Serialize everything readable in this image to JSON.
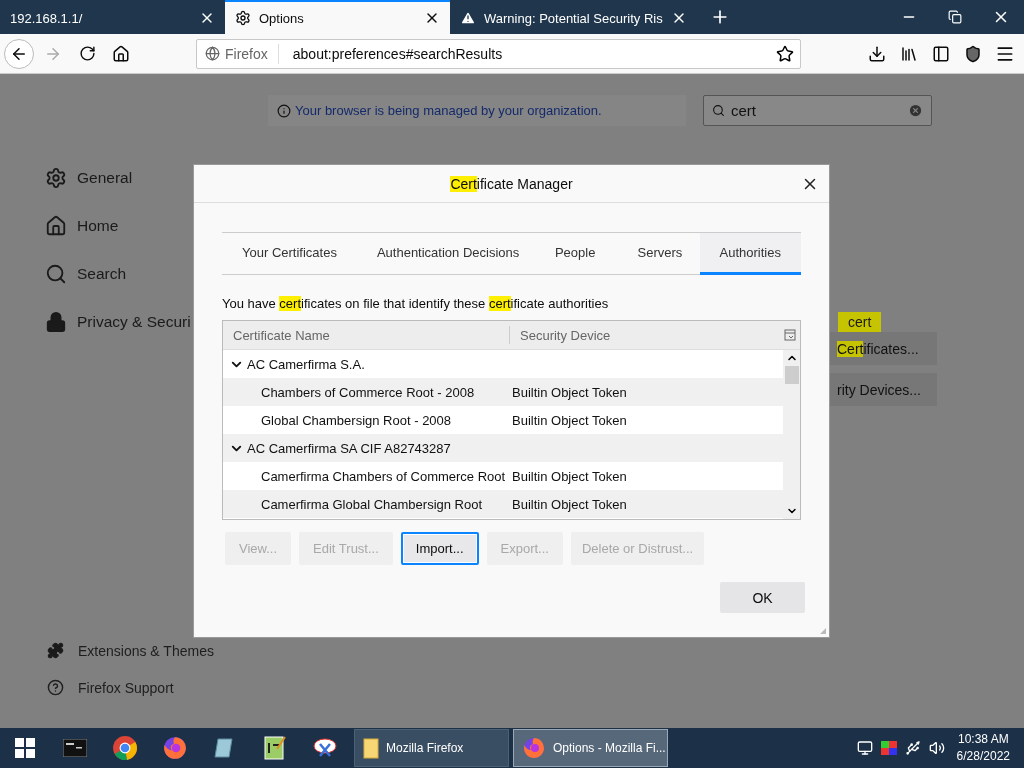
{
  "browser_tabs": [
    {
      "title": "192.168.1.1/",
      "kind": "plain",
      "selected": false
    },
    {
      "title": "Options",
      "kind": "settings",
      "selected": true
    },
    {
      "title": "Warning: Potential Security Ris",
      "kind": "warning",
      "selected": false
    }
  ],
  "nav": {
    "identity": "Firefox",
    "url": "about:preferences#searchResults",
    "forward_disabled": true
  },
  "managed_notice": "Your browser is being managed by your organization.",
  "search": {
    "value": "cert"
  },
  "sidebar": {
    "items": [
      {
        "label": "General",
        "kind": "general"
      },
      {
        "label": "Home",
        "kind": "home"
      },
      {
        "label": "Search",
        "kind": "search"
      },
      {
        "label": "Privacy & Securi",
        "kind": "privacy"
      }
    ],
    "footer": [
      {
        "label": "Extensions & Themes",
        "kind": "extensions"
      },
      {
        "label": "Firefox Support",
        "kind": "support"
      }
    ]
  },
  "results": {
    "tooltip": "cert",
    "buttons": [
      [
        {
          "text": "Cert",
          "highlight": true
        },
        {
          "text": "ificates...",
          "highlight": false
        }
      ],
      [
        {
          "text": "rity Devices...",
          "highlight": false
        }
      ]
    ]
  },
  "dialog": {
    "title": [
      {
        "text": "Cert",
        "highlight": true
      },
      {
        "text": "ificate Manager",
        "highlight": false
      }
    ],
    "tabs": [
      {
        "label": "Your Certificates",
        "selected": false
      },
      {
        "label": "Authentication Decisions",
        "selected": false
      },
      {
        "label": "People",
        "selected": false
      },
      {
        "label": "Servers",
        "selected": false
      },
      {
        "label": "Authorities",
        "selected": true
      }
    ],
    "description": [
      {
        "text": "You have ",
        "highlight": false
      },
      {
        "text": "cert",
        "highlight": true
      },
      {
        "text": "ificates on file that identify these ",
        "highlight": false
      },
      {
        "text": "cert",
        "highlight": true
      },
      {
        "text": "ificate authorities",
        "highlight": false
      }
    ],
    "columns": [
      "Certificate Name",
      "Security Device"
    ],
    "rows": [
      {
        "name": "AC Camerfirma S.A.",
        "expanded": true,
        "children": [
          {
            "name": "Chambers of Commerce Root - 2008",
            "device": "Builtin Object Token"
          },
          {
            "name": "Global Chambersign Root - 2008",
            "device": "Builtin Object Token"
          }
        ]
      },
      {
        "name": "AC Camerfirma SA CIF A82743287",
        "expanded": true,
        "children": [
          {
            "name": "Camerfirma Chambers of Commerce Root",
            "device": "Builtin Object Token"
          },
          {
            "name": "Camerfirma Global Chambersign Root",
            "device": "Builtin Object Token"
          }
        ]
      }
    ],
    "buttons": [
      {
        "label": "View...",
        "disabled": true,
        "focused": false
      },
      {
        "label": "Edit Trust...",
        "disabled": true,
        "focused": false
      },
      {
        "label": "Import...",
        "disabled": false,
        "focused": true
      },
      {
        "label": "Export...",
        "disabled": true,
        "focused": false
      },
      {
        "label": "Delete or Distrust...",
        "disabled": true,
        "focused": false
      }
    ],
    "ok": "OK"
  },
  "taskbar": {
    "tasks": [
      {
        "label": "Mozilla Firefox",
        "kind": "folder",
        "selected": false
      },
      {
        "label": "Options - Mozilla Fi...",
        "kind": "firefox",
        "selected": true
      }
    ],
    "clock": {
      "time": "10:38 AM",
      "date": "6/28/2022"
    }
  }
}
